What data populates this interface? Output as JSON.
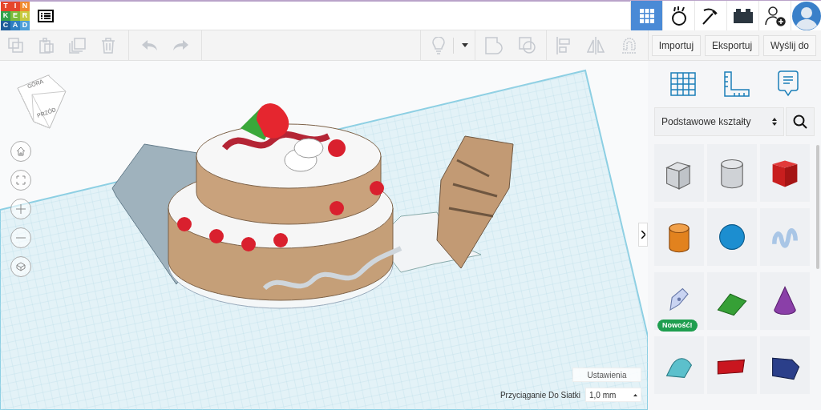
{
  "logo": {
    "letters": [
      "T",
      "I",
      "N",
      "K",
      "E",
      "R",
      "C",
      "A",
      "D"
    ]
  },
  "top_nav": [
    {
      "kind": "grid",
      "selected": true
    },
    {
      "kind": "blocks",
      "selected": false
    },
    {
      "kind": "pickaxe",
      "selected": false
    },
    {
      "kind": "brick",
      "selected": false
    },
    {
      "kind": "add-user",
      "selected": false
    },
    {
      "kind": "avatar",
      "selected": false
    }
  ],
  "toolbar": {
    "actions": [
      "Importuj",
      "Eksportuj",
      "Wyślij do"
    ]
  },
  "view_cube": {
    "faces": [
      "GÓRA",
      "PRZÓD"
    ]
  },
  "sidebar": {
    "category": "Podstawowe kształty",
    "shapes": [
      {
        "kind": "hole-box"
      },
      {
        "kind": "hole-cylinder"
      },
      {
        "kind": "box"
      },
      {
        "kind": "cylinder"
      },
      {
        "kind": "sphere"
      },
      {
        "kind": "scribble"
      },
      {
        "kind": "pen",
        "badge": "Nowość!"
      },
      {
        "kind": "roof"
      },
      {
        "kind": "cone"
      },
      {
        "kind": "round-roof"
      },
      {
        "kind": "text"
      },
      {
        "kind": "polygon"
      }
    ]
  },
  "snap": {
    "settings_button": "Ustawienia",
    "label": "Przyciąganie Do Siatki",
    "value": "1,0 mm"
  }
}
